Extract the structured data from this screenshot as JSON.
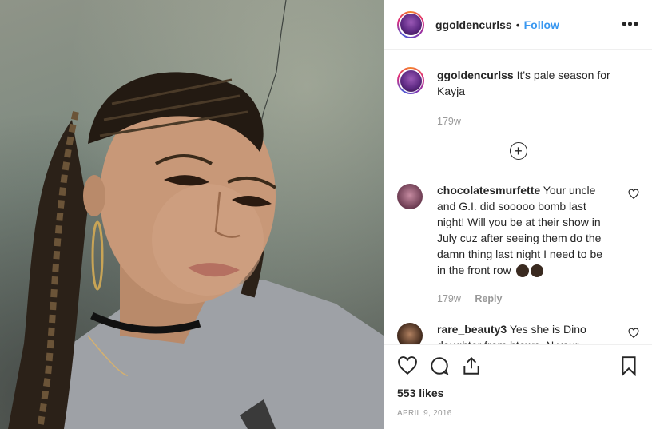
{
  "header": {
    "username": "ggoldencurlss",
    "separator": "•",
    "follow_label": "Follow",
    "more_label": "•••"
  },
  "caption": {
    "username": "ggoldencurlss",
    "text": "It's pale season for Kayja",
    "time": "179w"
  },
  "load_more_label": "+",
  "comments": [
    {
      "username": "chocolatesmurfette",
      "text": "Your uncle and G.I. did sooooo bomb last night! Will you be at their show in July cuz after seeing them do the damn thing last night I need to be in the front row",
      "time": "179w",
      "reply_label": "Reply"
    },
    {
      "username": "rare_beauty3",
      "text": "Yes she is Dino daughter from htown. N your beautiful Hun n love the music"
    }
  ],
  "likes": "553 likes",
  "date": "APRIL 9, 2016",
  "colors": {
    "accent": "#3897f0",
    "muted": "#999999",
    "text": "#262626"
  }
}
